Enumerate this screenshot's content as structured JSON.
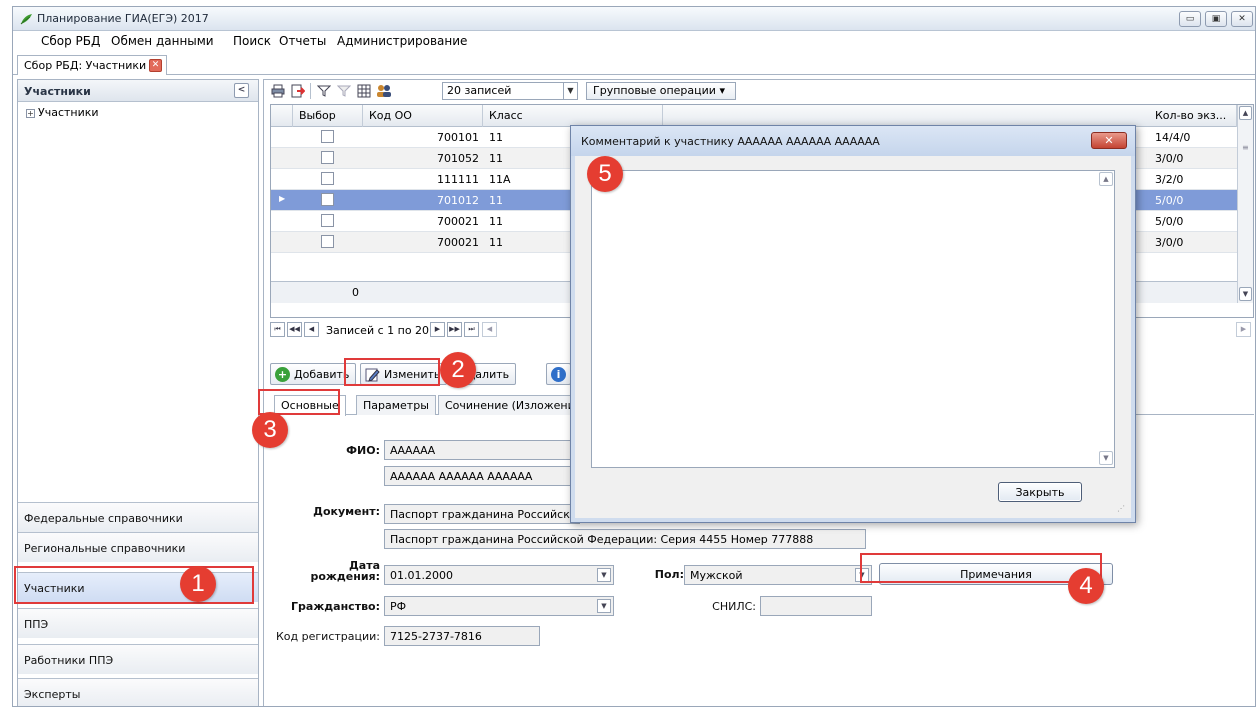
{
  "window": {
    "title": "Планирование ГИА(ЕГЭ) 2017",
    "buttons": {
      "minimize": "▭",
      "maximize": "▣",
      "close": "✕"
    }
  },
  "menu": [
    "Сбор РБД",
    "Обмен данными",
    "Поиск",
    "Отчеты",
    "Администрирование"
  ],
  "doc_tab": {
    "label": "Сбор РБД: Участники",
    "close": "✕"
  },
  "left_panel": {
    "header": "Участники",
    "collapse_glyph": "<",
    "tree": {
      "expander": "+",
      "label": "Участники"
    },
    "nav": [
      "Федеральные справочники",
      "Региональные справочники",
      "Участники",
      "ППЭ",
      "Работники ППЭ",
      "Эксперты"
    ]
  },
  "toolbar": {
    "records_select": "20 записей",
    "group_ops": "Групповые операции ▾"
  },
  "grid": {
    "headers": [
      "Выбор",
      "Код ОО",
      "Класс",
      "Кол-во экз..."
    ],
    "rows": [
      {
        "code": "700101",
        "class": "11",
        "exams": "14/4/0"
      },
      {
        "code": "701052",
        "class": "11",
        "exams": "3/0/0"
      },
      {
        "code": "111111",
        "class": "11А",
        "exams": "3/2/0"
      },
      {
        "code": "701012",
        "class": "11",
        "exams": "5/0/0"
      },
      {
        "code": "700021",
        "class": "11",
        "exams": "5/0/0"
      },
      {
        "code": "700021",
        "class": "11",
        "exams": "3/0/0"
      }
    ],
    "footer_count": "0"
  },
  "pager": {
    "text": "Записей с 1 по 20"
  },
  "actions": {
    "add": "Добавить",
    "edit": "Изменить",
    "delete": "Удалить"
  },
  "form_tabs": [
    "Основные",
    "Параметры",
    "Сочинение (Изложение"
  ],
  "form": {
    "fio_label": "ФИО:",
    "fio_1": "АААААА",
    "fio_2": "АААААА АААААА АААААА",
    "doc_label": "Документ:",
    "doc_type": "Паспорт гражданина Российской",
    "doc_full": "Паспорт гражданина Российской Федерации: Серия 4455 Номер 777888",
    "dob_label": "Дата рождения:",
    "dob": "01.01.2000",
    "gender_label": "Пол:",
    "gender": "Мужской",
    "notes_btn": "Примечания",
    "citizenship_label": "Гражданство:",
    "citizenship": "РФ",
    "snils_label": "СНИЛС:",
    "snils": "",
    "reg_label": "Код регистрации:",
    "reg_code": "7125-2737-7816"
  },
  "dialog": {
    "title": "Комментарий к участнику АААААА АААААА АААААА",
    "close_glyph": "✕",
    "comment": "",
    "close_btn": "Закрыть"
  },
  "badges": [
    "1",
    "2",
    "3",
    "4",
    "5"
  ],
  "colors": {
    "badge": "#e53d31",
    "highlight": "#e03a3a",
    "row_selected": "#7f9bd8"
  }
}
